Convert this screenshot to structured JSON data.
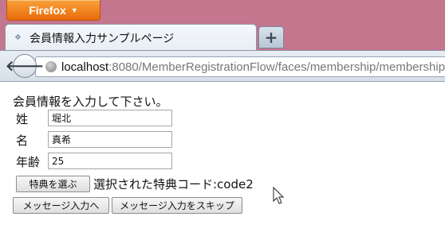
{
  "browser": {
    "app_button_label": "Firefox",
    "tab_title": "会員情報入力サンプルページ",
    "new_tab_symbol": "+",
    "url_host": "localhost",
    "url_path": ":8080/MemberRegistrationFlow/faces/membership/membership"
  },
  "form": {
    "intro": "会員情報を入力して下さい。",
    "last_name_label": "姓",
    "last_name_value": "堀北",
    "first_name_label": "名",
    "first_name_value": "真希",
    "age_label": "年齢",
    "age_value": "25",
    "choose_benefit_button": "特典を選ぶ",
    "selected_benefit_text": "選択された特典コード:code2",
    "to_message_button": "メッセージ入力へ",
    "skip_message_button": "メッセージ入力をスキップ"
  },
  "colors": {
    "titlebar": "#c4768f",
    "firefox_button": "#e96b0a"
  },
  "icons": [
    "back-arrow-icon",
    "globe-icon",
    "tab-favicon-icon",
    "mouse-cursor-icon",
    "dropdown-caret-icon"
  ]
}
